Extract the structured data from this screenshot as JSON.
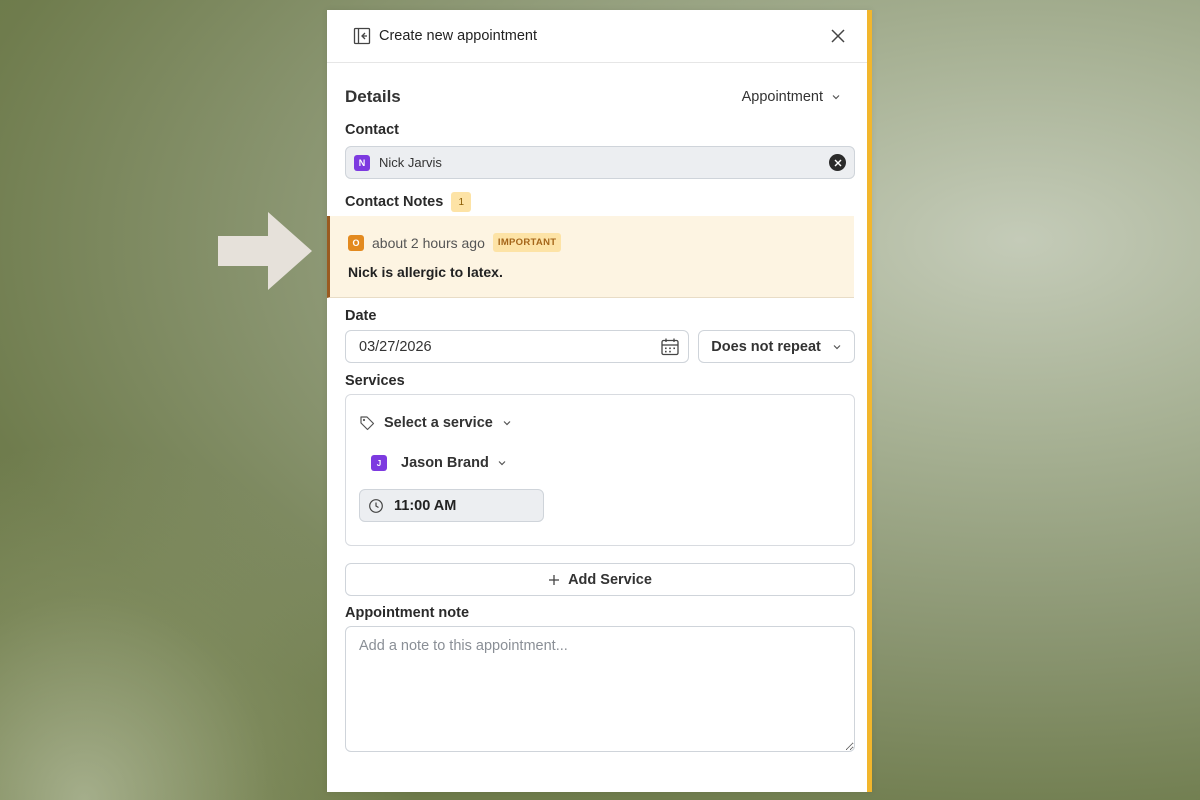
{
  "header": {
    "title": "Create new appointment"
  },
  "details": {
    "title": "Details",
    "type_select": "Appointment"
  },
  "contact": {
    "label": "Contact",
    "avatar_initial": "N",
    "name": "Nick Jarvis"
  },
  "contact_notes": {
    "label": "Contact Notes",
    "count": "1",
    "note": {
      "avatar_initial": "O",
      "time": "about 2 hours ago",
      "badge": "IMPORTANT",
      "text": "Nick is allergic to latex."
    }
  },
  "date": {
    "label": "Date",
    "value": "03/27/2026",
    "repeat": "Does not repeat"
  },
  "services": {
    "label": "Services",
    "select_placeholder": "Select a service",
    "staff_initial": "J",
    "staff_name": "Jason Brand",
    "time": "11:00 AM",
    "add_label": "Add Service"
  },
  "appointment_note": {
    "label": "Appointment note",
    "placeholder": "Add a note to this appointment..."
  },
  "colors": {
    "accent_border": "#f2b62c",
    "contact_avatar": "#7d3ae0",
    "note_avatar": "#e38a1f",
    "note_bg": "#fdf4e2"
  }
}
